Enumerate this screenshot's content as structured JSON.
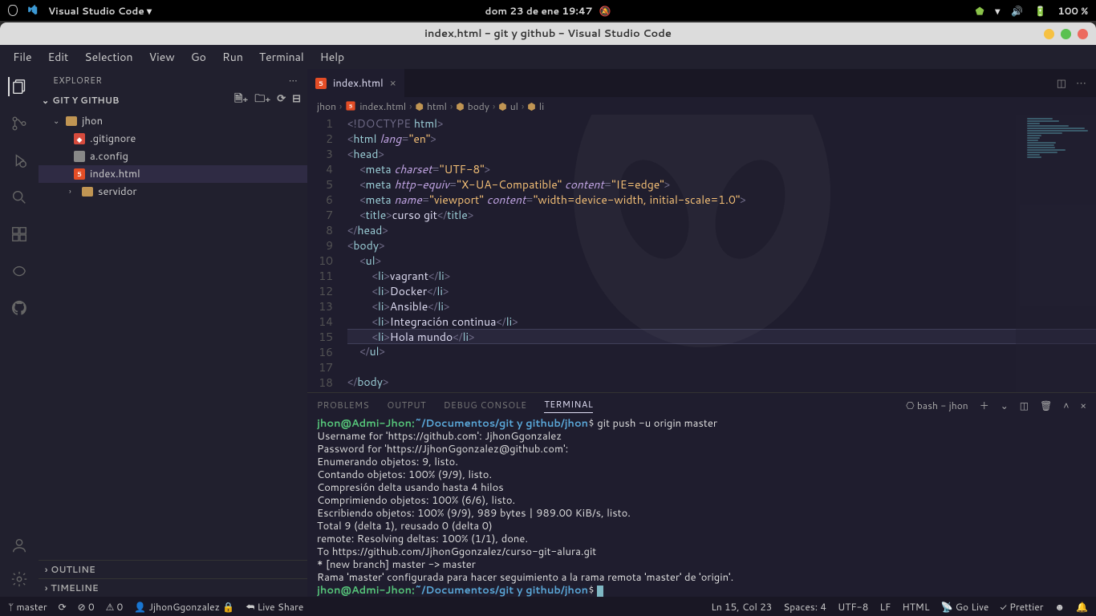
{
  "topbar": {
    "app_label": "Visual Studio Code ▾",
    "datetime": "dom 23 de ene  19:47",
    "battery": "100 %"
  },
  "titlebar": {
    "title": "index.html - git y github - Visual Studio Code"
  },
  "menubar": [
    "File",
    "Edit",
    "Selection",
    "View",
    "Go",
    "Run",
    "Terminal",
    "Help"
  ],
  "sidebar": {
    "header": "EXPLORER",
    "project": "GIT Y GITHUB",
    "tree": {
      "jhon": "jhon",
      "gitignore": ".gitignore",
      "aconfig": "a.config",
      "index": "index.html",
      "servidor": "servidor"
    },
    "outline": "OUTLINE",
    "timeline": "TIMELINE"
  },
  "tabs": {
    "t1": "index.html"
  },
  "breadcrumb": {
    "p1": "jhon",
    "p2": "index.html",
    "p3": "html",
    "p4": "body",
    "p5": "ul",
    "p6": "li"
  },
  "gutter": [
    "1",
    "2",
    "3",
    "4",
    "5",
    "6",
    "7",
    "8",
    "9",
    "10",
    "11",
    "12",
    "13",
    "14",
    "15",
    "16",
    "17",
    "18"
  ],
  "panel": {
    "tabs": {
      "problems": "PROBLEMS",
      "output": "OUTPUT",
      "debug": "DEBUG CONSOLE",
      "terminal": "TERMINAL"
    },
    "shell": "bash - jhon"
  },
  "terminal": {
    "prompt_user": "jhon@Admi-Jhon",
    "prompt_path": "~/Documentos/git y github/jhon",
    "cmd1": " git push -u origin master",
    "l2": "Username for 'https://github.com': JjhonGgonzalez",
    "l3": "Password for 'https://JjhonGgonzalez@github.com': ",
    "l4": "Enumerando objetos: 9, listo.",
    "l5": "Contando objetos: 100% (9/9), listo.",
    "l6": "Compresión delta usando hasta 4 hilos",
    "l7": "Comprimiendo objetos: 100% (6/6), listo.",
    "l8": "Escribiendo objetos: 100% (9/9), 989 bytes | 989.00 KiB/s, listo.",
    "l9": "Total 9 (delta 1), reusado 0 (delta 0)",
    "l10": "remote: Resolving deltas: 100% (1/1), done.",
    "l11": "To https://github.com/JjhonGgonzalez/curso-git-alura.git",
    "l12": " * [new branch]      master -> master",
    "l13": "Rama 'master' configurada para hacer seguimiento a la rama remota 'master' de 'origin'."
  },
  "statusbar": {
    "branch": "master",
    "sync": "⟳",
    "errors": "⊘ 0",
    "warnings": "⚠ 0",
    "user": "JjhonGgonzalez",
    "live": "Live Share",
    "pos": "Ln 15, Col 23",
    "spaces": "Spaces: 4",
    "enc": "UTF-8",
    "eol": "LF",
    "lang": "HTML",
    "golive": "Go Live",
    "prettier": "Prettier"
  }
}
